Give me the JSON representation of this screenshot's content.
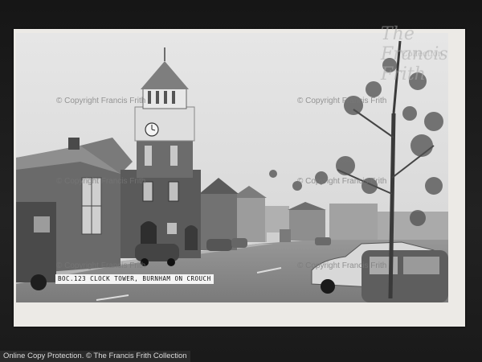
{
  "photo": {
    "caption": "BOC.123    CLOCK TOWER, BURNHAM ON CROUCH",
    "clock_face_icon": "clock-face-icon"
  },
  "watermarks": [
    "© Copyright Francis Frith",
    "© Copyright Francis Frith",
    "© Copyright Francis Frith",
    "© Copyright Francis Frith",
    "© Copyright Francis Frith",
    "© Copyright Francis Frith"
  ],
  "logo": {
    "line1": "The Francis Frith",
    "line2": "Collection"
  },
  "footer": {
    "text": "Online Copy Protection. © The Francis Frith Collection"
  }
}
